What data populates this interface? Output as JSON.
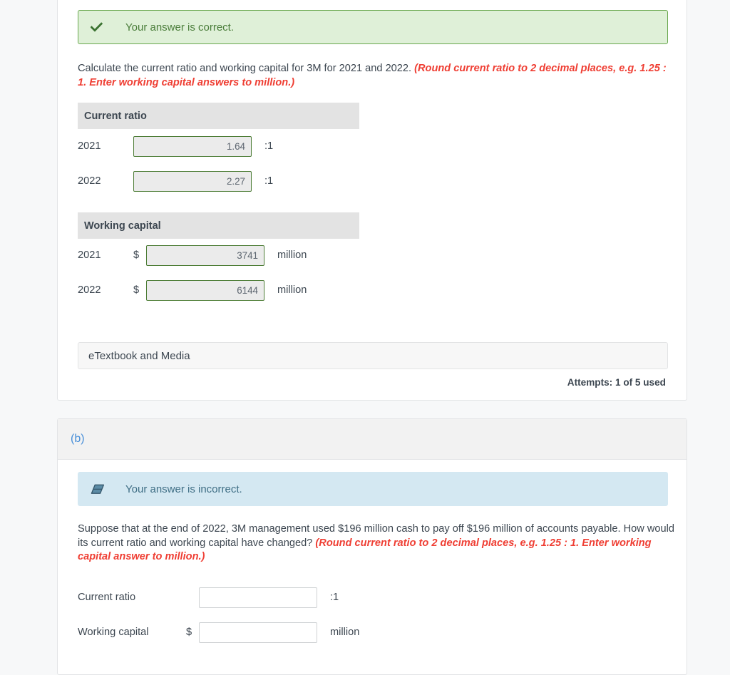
{
  "part_a": {
    "status": {
      "icon": "check-icon",
      "text": "Your answer is correct.",
      "bg_color": "#dff0d8",
      "border_color": "#6aa84f"
    },
    "question": {
      "main": "Calculate the current ratio and working capital for 3M for 2021 and 2022. ",
      "hint": "(Round current ratio to 2 decimal places, e.g. 1.25 : 1. Enter working capital answers to million.)"
    },
    "current_ratio": {
      "header": "Current ratio",
      "rows": [
        {
          "label": "2021",
          "value": "1.64",
          "unit": ":1"
        },
        {
          "label": "2022",
          "value": "2.27",
          "unit": ":1"
        }
      ]
    },
    "working_capital": {
      "header": "Working capital",
      "currency": "$",
      "rows": [
        {
          "label": "2021",
          "value": "3741",
          "unit": "million"
        },
        {
          "label": "2022",
          "value": "6144",
          "unit": "million"
        }
      ]
    },
    "etextbook_label": "eTextbook and Media",
    "attempts": "Attempts: 1 of 5 used"
  },
  "part_b": {
    "part_label": "(b)",
    "status": {
      "icon": "eraser-icon",
      "text": "Your answer is incorrect.",
      "bg_color": "#d4e8f2",
      "icon_color": "#3f6e85"
    },
    "question": {
      "main": "Suppose that at the end of 2022, 3M management used $196 million cash to pay off $196 million of accounts payable. How would its current ratio and working capital have changed? ",
      "hint": "(Round current ratio to 2 decimal places, e.g. 1.25 : 1. Enter working capital answer to million.)"
    },
    "rows": [
      {
        "label": "Current ratio",
        "currency": "",
        "value": "",
        "unit": ":1"
      },
      {
        "label": "Working capital",
        "currency": "$",
        "value": "",
        "unit": "million"
      }
    ]
  }
}
